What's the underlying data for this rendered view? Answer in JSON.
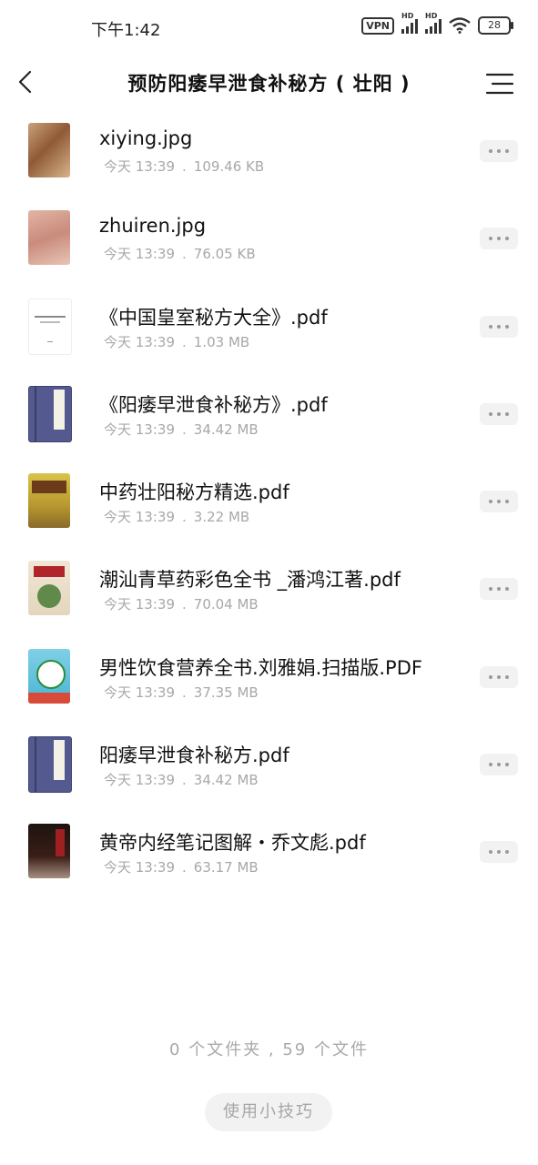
{
  "status_bar": {
    "time": "下午1:42",
    "vpn_label": "VPN",
    "hd_label_1": "HD",
    "hd_label_2": "HD",
    "battery": "28"
  },
  "header": {
    "title": "预防阳痿早泄食补秘方 ( 壮阳 )",
    "back_icon": "back-icon",
    "menu_icon": "menu-icon"
  },
  "files": [
    {
      "name": "xiying.jpg",
      "date": "今天 13:39",
      "size": "109.46 KB",
      "thumb": "image"
    },
    {
      "name": "zhuiren.jpg",
      "date": "今天 13:39",
      "size": "76.05 KB",
      "thumb": "image"
    },
    {
      "name": "《中国皇室秘方大全》.pdf",
      "date": "今天 13:39",
      "size": "1.03 MB",
      "thumb": "document"
    },
    {
      "name": "《阳痿早泄食补秘方》.pdf",
      "date": "今天 13:39",
      "size": "34.42 MB",
      "thumb": "book-cover"
    },
    {
      "name": "中药壮阳秘方精选.pdf",
      "date": "今天 13:39",
      "size": "3.22 MB",
      "thumb": "book-cover"
    },
    {
      "name": "潮汕青草药彩色全书 _潘鸿江著.pdf",
      "date": "今天 13:39",
      "size": "70.04 MB",
      "thumb": "book-cover"
    },
    {
      "name": "男性饮食营养全书.刘雅娟.扫描版.PDF",
      "date": "今天 13:39",
      "size": "37.35 MB",
      "thumb": "book-cover"
    },
    {
      "name": "阳痿早泄食补秘方.pdf",
      "date": "今天 13:39",
      "size": "34.42 MB",
      "thumb": "book-cover"
    },
    {
      "name": "黄帝内经笔记图解・乔文彪.pdf",
      "date": "今天 13:39",
      "size": "63.17 MB",
      "thumb": "book-cover"
    }
  ],
  "meta_separator": ".",
  "summary": "0 个文件夹 , 59 个文件",
  "tips_button": "使用小技巧"
}
